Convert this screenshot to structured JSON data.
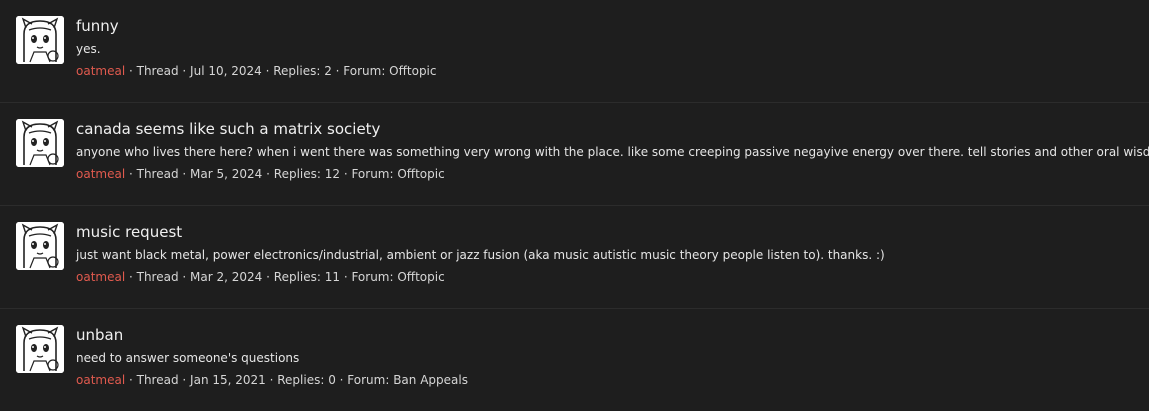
{
  "results": [
    {
      "title": "funny",
      "snippet": "yes.",
      "author": "oatmeal",
      "type": "Thread",
      "date": "Jul 10, 2024",
      "replies_label": "Replies: 2",
      "forum_label": "Forum: Offtopic",
      "avatar_icon": "user-avatar-icon"
    },
    {
      "title": "canada seems like such a matrix society",
      "snippet": "anyone who lives there here? when i went there was something very wrong with the place. like some creeping passive negayive energy over there. tell stories and other oral wisdom pls.",
      "author": "oatmeal",
      "type": "Thread",
      "date": "Mar 5, 2024",
      "replies_label": "Replies: 12",
      "forum_label": "Forum: Offtopic",
      "avatar_icon": "user-avatar-icon"
    },
    {
      "title": "music request",
      "snippet": "just want black metal, power electronics/industrial, ambient or jazz fusion (aka music autistic music theory people listen to). thanks. :)",
      "author": "oatmeal",
      "type": "Thread",
      "date": "Mar 2, 2024",
      "replies_label": "Replies: 11",
      "forum_label": "Forum: Offtopic",
      "avatar_icon": "user-avatar-icon"
    },
    {
      "title": "unban",
      "snippet": "need to answer someone's questions",
      "author": "oatmeal",
      "type": "Thread",
      "date": "Jan 15, 2021",
      "replies_label": "Replies: 0",
      "forum_label": "Forum: Ban Appeals",
      "avatar_icon": "user-avatar-icon"
    }
  ],
  "separator": " · ",
  "colors": {
    "background": "#1e1e1e",
    "username": "#e05a4e",
    "title": "#f0f0f0"
  }
}
